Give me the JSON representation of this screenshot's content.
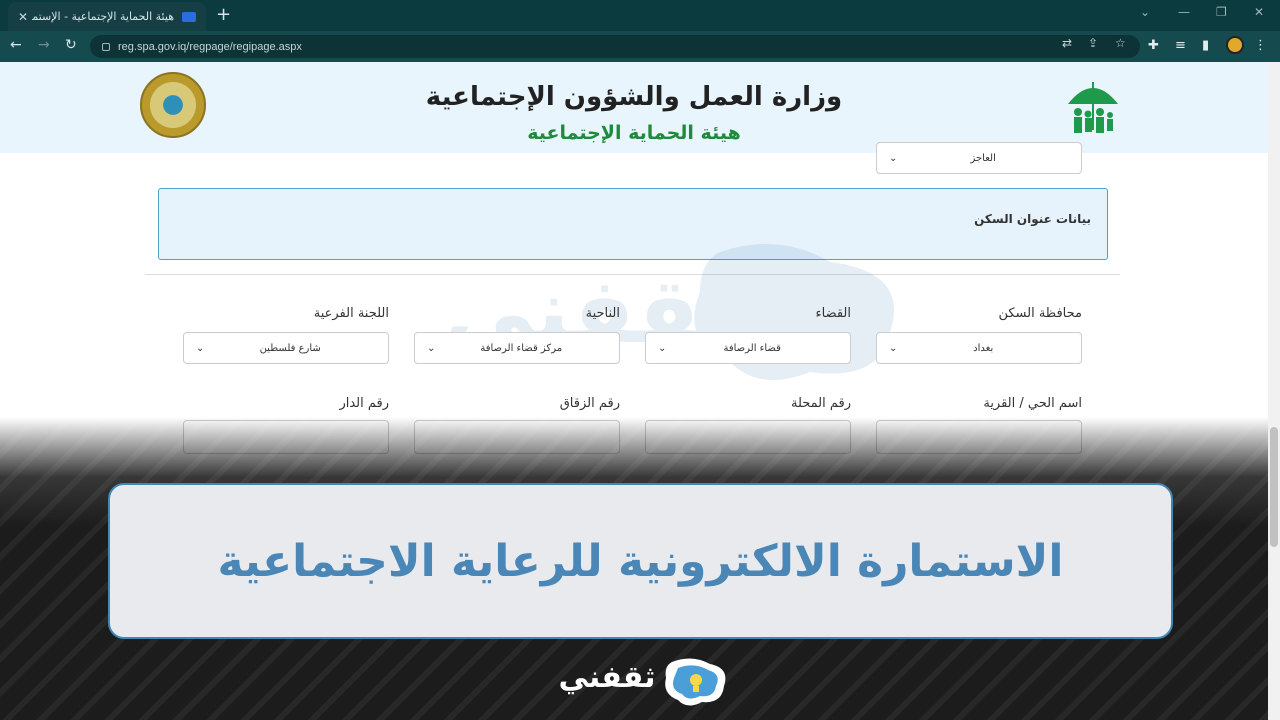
{
  "browser": {
    "tab_title": "هيئة الحماية الإجتماعية - الإستمارة الإ",
    "tab_close": "✕",
    "new_tab": "+",
    "url": "reg.spa.gov.iq/regpage/regipage.aspx",
    "controls": {
      "minimize": "—",
      "maximize": "❐",
      "close": "✕",
      "dropdown": "⌄"
    }
  },
  "header": {
    "ministry": "وزارة العمل والشؤون الإجتماعية",
    "authority": "هيئة الحماية الإجتماعية"
  },
  "top_select": {
    "value": "العاجز"
  },
  "section": {
    "title": "بيانات عنوان السكن"
  },
  "address_row": [
    {
      "label": "محافظة السكن",
      "value": "بغداد"
    },
    {
      "label": "القضاء",
      "value": "قضاء الرصافة"
    },
    {
      "label": "الناحية",
      "value": "مركز قضاء الرصافة"
    },
    {
      "label": "اللجنة الفرعية",
      "value": "شارع فلسطين"
    }
  ],
  "details_row": [
    {
      "label": "اسم الحي / القرية"
    },
    {
      "label": "رقم المحلة"
    },
    {
      "label": "رقم الزقاق"
    },
    {
      "label": "رقم الدار"
    }
  ],
  "banner": {
    "title": "الاستمارة الالكترونية للرعاية الاجتماعية"
  },
  "watermark": {
    "text": "ثقفني"
  },
  "footer_logo": {
    "text": "ثقفني"
  },
  "colors": {
    "chrome": "#0b3a3f",
    "header_bg": "#e8f5fc",
    "authority_green": "#1e8a3a",
    "banner_text": "#4a86b6",
    "banner_border": "#3f88b8"
  }
}
